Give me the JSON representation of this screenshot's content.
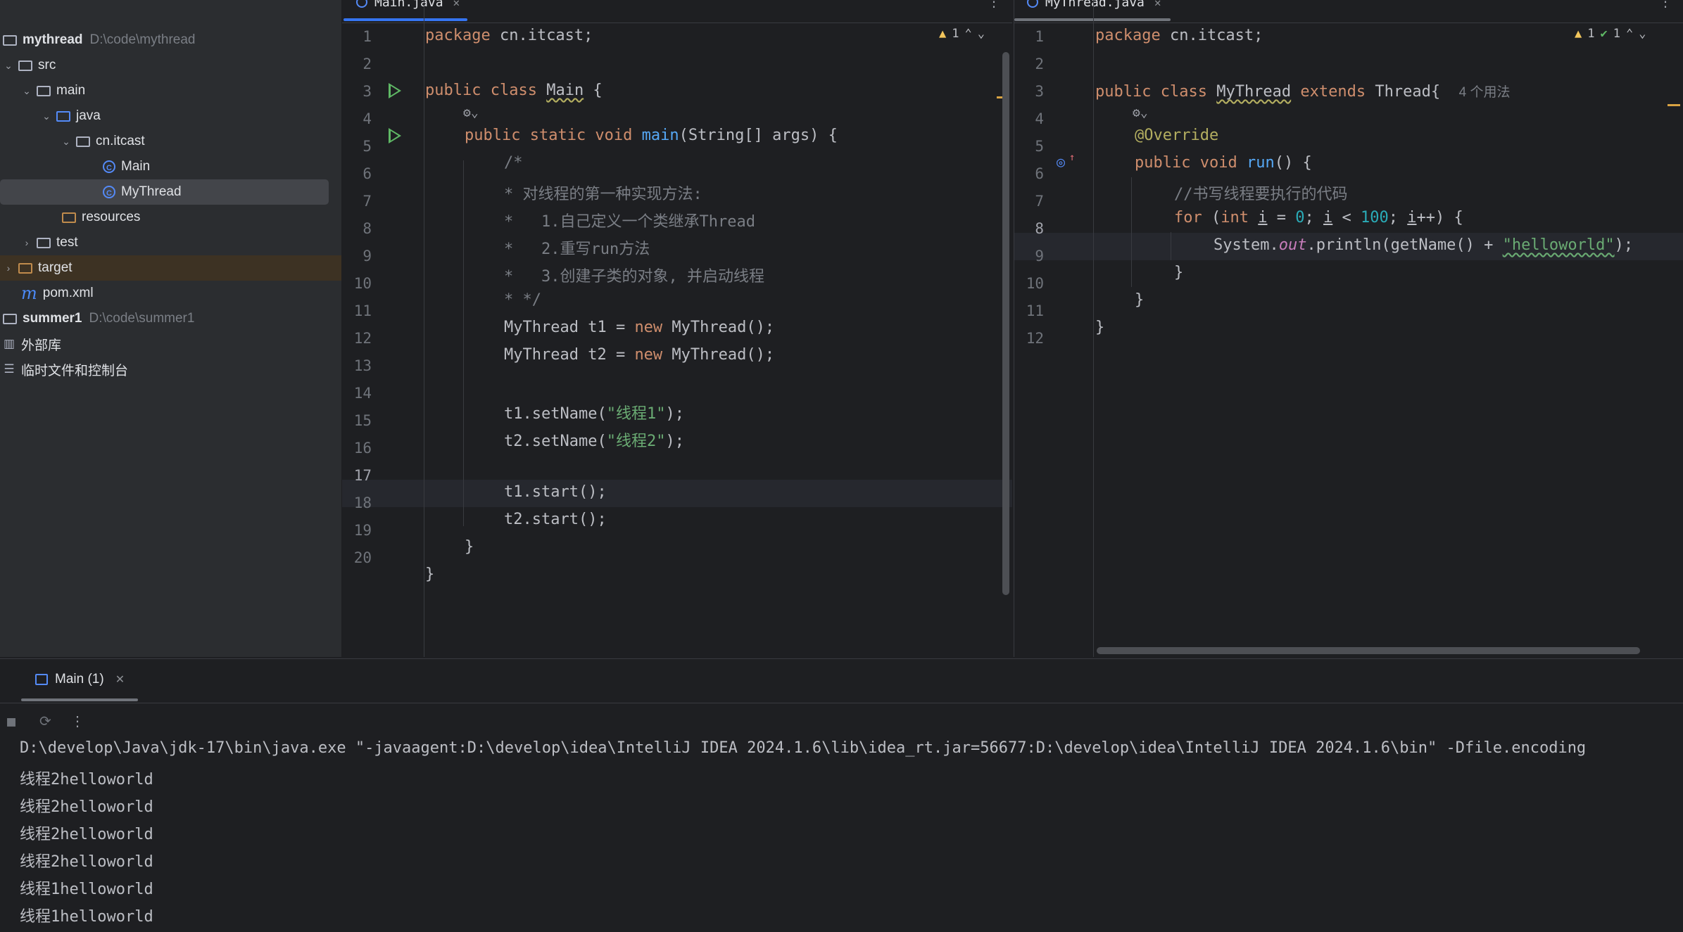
{
  "project_tree": {
    "rows": [
      {
        "label": "mythread",
        "path": "D:\\code\\mythread"
      },
      {
        "label": "src"
      },
      {
        "label": "main"
      },
      {
        "label": "java"
      },
      {
        "label": "cn.itcast"
      },
      {
        "label": "Main"
      },
      {
        "label": "MyThread"
      },
      {
        "label": "resources"
      },
      {
        "label": "test"
      },
      {
        "label": "target"
      },
      {
        "label": "pom.xml"
      },
      {
        "label": "summer1",
        "path": "D:\\code\\summer1"
      },
      {
        "label": "外部库"
      },
      {
        "label": "临时文件和控制台"
      }
    ]
  },
  "editor_left": {
    "tab_label": "Main.java",
    "inspection_count": "1",
    "line_numbers": [
      "1",
      "2",
      "3",
      "4",
      "5",
      "6",
      "7",
      "8",
      "9",
      "10",
      "11",
      "12",
      "13",
      "14",
      "15",
      "16",
      "17",
      "18",
      "19",
      "20"
    ],
    "code": {
      "l1_kw": "package",
      "l1_rest": " cn.itcast;",
      "l3_kw": "public class",
      "l3_name": "Main",
      "l3_rest": " {",
      "l4_kw": "public static void",
      "l4_fn": "main",
      "l4_rest": "(String[] args) {",
      "l5": "/*",
      "l6": "* 对线程的第一种实现方法:",
      "l7": "*   1.自己定义一个类继承Thread",
      "l8": "*   2.重写run方法",
      "l9": "*   3.创建子类的对象, 并启动线程",
      "l10": "* */",
      "l11_a": "MyThread t1 = ",
      "l11_kw": "new",
      "l11_b": " MyThread();",
      "l12_a": "MyThread t2 = ",
      "l12_kw": "new",
      "l12_b": " MyThread();",
      "l14_a": "t1.setName(",
      "l14_str": "\"线程1\"",
      "l14_b": ");",
      "l15_a": "t2.setName(",
      "l15_str": "\"线程2\"",
      "l15_b": ");",
      "l17": "t1.start();",
      "l18": "t2.start();",
      "l19": "}",
      "l20": "}"
    }
  },
  "editor_right": {
    "tab_label": "MyThread.java",
    "warning_count": "1",
    "ok_count": "1",
    "line_numbers": [
      "1",
      "2",
      "3",
      "4",
      "5",
      "6",
      "7",
      "8",
      "9",
      "10",
      "11",
      "12"
    ],
    "code": {
      "l1_kw": "package",
      "l1_rest": " cn.itcast;",
      "l3_kw": "public class",
      "l3_name": "MyThread",
      "l3_kw2": "extends",
      "l3_rest": " Thread{",
      "l3_usages": "4 个用法",
      "l4": "@Override",
      "l5_kw": "public void",
      "l5_fn": "run",
      "l5_rest": "() {",
      "l6": "//书写线程要执行的代码",
      "l7_kw": "for",
      "l7_a": " (",
      "l7_kw2": "int",
      "l7_i1": "i",
      "l7_b": " = ",
      "l7_n0": "0",
      "l7_c": "; ",
      "l7_i2": "i",
      "l7_d": " < ",
      "l7_n100": "100",
      "l7_e": "; ",
      "l7_i3": "i",
      "l7_f": "++) {",
      "l8_a": "System.",
      "l8_out": "out",
      "l8_b": ".println(getName() + ",
      "l8_str": "\"helloworld\"",
      "l8_c": ");",
      "l9": "}",
      "l10": "}",
      "l11": "}"
    }
  },
  "run_panel": {
    "tab_label": "Main (1)",
    "console_lines": [
      "D:\\develop\\Java\\jdk-17\\bin\\java.exe \"-javaagent:D:\\develop\\idea\\IntelliJ IDEA 2024.1.6\\lib\\idea_rt.jar=56677:D:\\develop\\idea\\IntelliJ IDEA 2024.1.6\\bin\" -Dfile.encoding",
      "线程2helloworld",
      "线程2helloworld",
      "线程2helloworld",
      "线程2helloworld",
      "线程1helloworld",
      "线程1helloworld"
    ]
  }
}
